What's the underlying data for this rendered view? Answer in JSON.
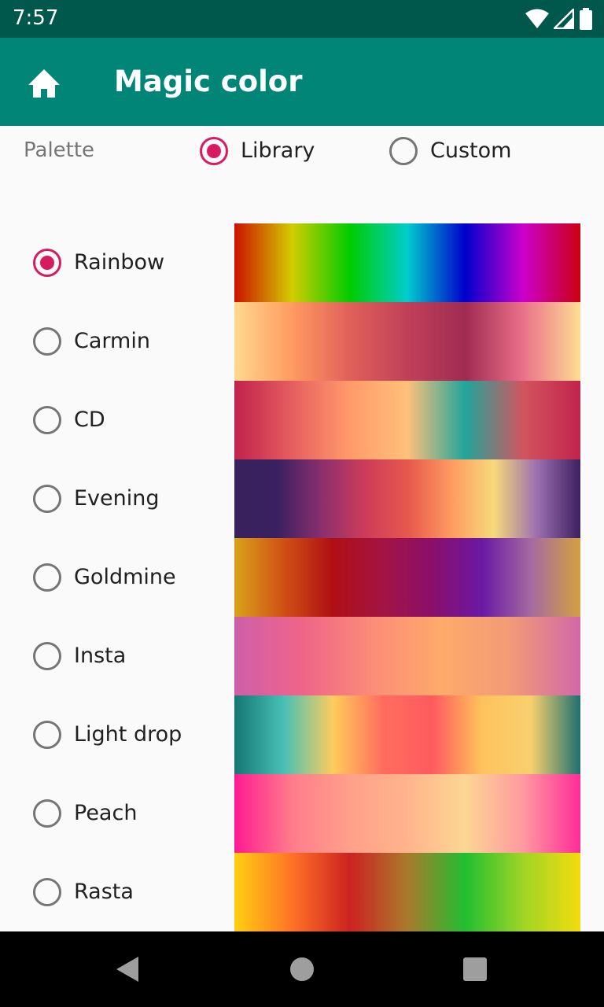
{
  "status": {
    "time": "7:57"
  },
  "appbar": {
    "title": "Magic color"
  },
  "palette": {
    "label": "Palette",
    "options": [
      {
        "label": "Library",
        "selected": true
      },
      {
        "label": "Custom",
        "selected": false
      }
    ]
  },
  "gradients": [
    {
      "name": "Rainbow",
      "selected": true,
      "colors": [
        "#cc1100",
        "#d2cc00",
        "#00cc00",
        "#00cccc",
        "#0000cc",
        "#cc00cc",
        "#cc0011"
      ]
    },
    {
      "name": "Carmin",
      "selected": false,
      "colors": [
        "#ffd98f",
        "#ff9a60",
        "#e0605a",
        "#c0405a",
        "#a02c52",
        "#e9708a",
        "#ffdc94"
      ]
    },
    {
      "name": "CD",
      "selected": false,
      "colors": [
        "#c0224c",
        "#e65e60",
        "#ff9a6a",
        "#ffc07a",
        "#21a59b",
        "#d2555f",
        "#c2244c"
      ]
    },
    {
      "name": "Evening",
      "selected": false,
      "colors": [
        "#38215c",
        "#3a2060",
        "#8a2f6e",
        "#cc3c5a",
        "#e6574d",
        "#ff9960",
        "#f6d97a",
        "#9c6fb0",
        "#3c2060"
      ]
    },
    {
      "name": "Goldmine",
      "selected": false,
      "colors": [
        "#d9a21b",
        "#d05014",
        "#b00f14",
        "#a31443",
        "#8a0f6a",
        "#6a18a4",
        "#a46aa0",
        "#d4a040"
      ]
    },
    {
      "name": "Insta",
      "selected": false,
      "colors": [
        "#ce5eaa",
        "#ef6588",
        "#fb8c78",
        "#fdaa6a",
        "#f29a78",
        "#d268a8"
      ]
    },
    {
      "name": "Light drop",
      "selected": false,
      "colors": [
        "#147672",
        "#48c0b6",
        "#ffcc5c",
        "#ff6d5e",
        "#ff5a5e",
        "#ffc25c",
        "#f7d06e",
        "#1e7070"
      ]
    },
    {
      "name": "Peach",
      "selected": false,
      "colors": [
        "#ff1a92",
        "#ff7c8c",
        "#ffa08a",
        "#ffb48c",
        "#fcd694",
        "#ff9aa0",
        "#ff2c98"
      ]
    },
    {
      "name": "Rasta",
      "selected": false,
      "colors": [
        "#ffd012",
        "#ff7226",
        "#cc2222",
        "#aa7a2c",
        "#22be32",
        "#9ed426",
        "#f2dc0e"
      ]
    }
  ]
}
